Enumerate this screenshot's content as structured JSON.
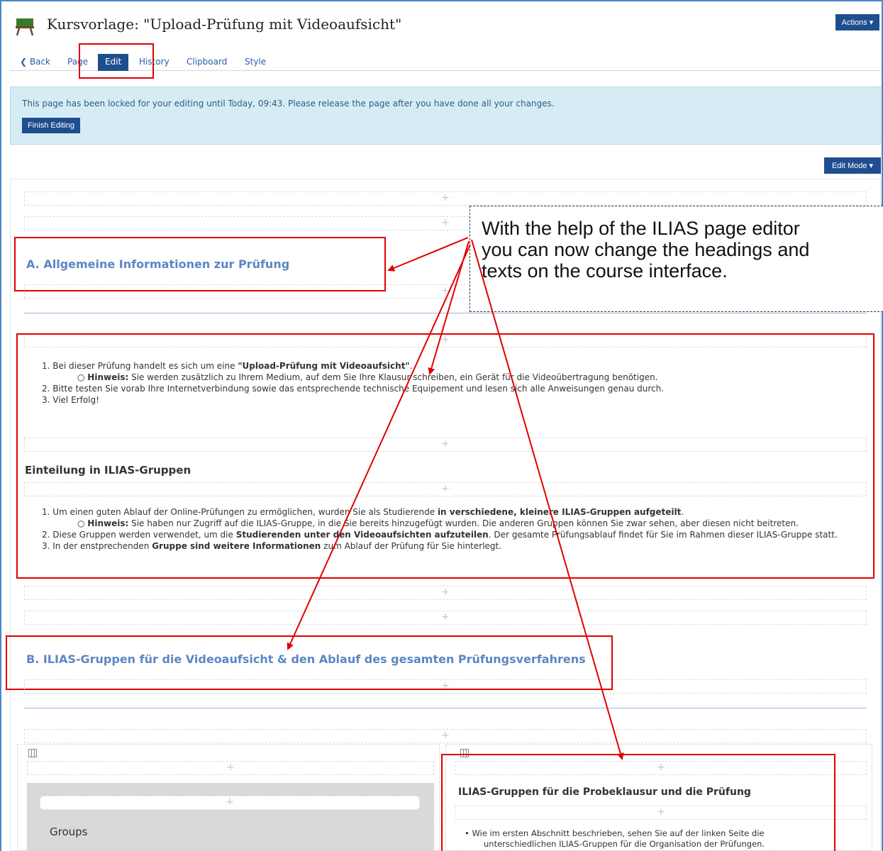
{
  "header": {
    "title": "Kursvorlage: \"Upload-Prüfung mit Videoaufsicht\"",
    "actions_label": "Actions ▾"
  },
  "tabs": {
    "back": "❮ Back",
    "page": "Page",
    "edit": "Edit",
    "history": "History",
    "clipboard": "Clipboard",
    "style": "Style"
  },
  "lock": {
    "message": "This page has been locked for your editing until Today, 09:43. Please release the page after you have done all your changes.",
    "finish_label": "Finish Editing"
  },
  "edit_mode_label": "Edit Mode ▾",
  "placeholder_glyph": "+",
  "section_a": {
    "heading": "A. Allgemeine Informationen zur Prüfung",
    "items": {
      "i1_pre": "1. Bei dieser Prüfung handelt es sich um eine ",
      "i1_bold": "\"Upload-Prüfung mit Videoaufsicht\"",
      "i1_post": ".",
      "i1a_bold": "Hinweis:",
      "i1a_text": " Sie werden zusätzlich zu Ihrem Medium, auf dem Sie Ihre Klausur schreiben, ein Gerät für die Videoübertragung benötigen.",
      "i2": "2. Bitte testen Sie vorab Ihre Internetverbindung sowie das entsprechende technische Equipement und lesen sich alle Anweisungen genau durch.",
      "i3": "3. Viel Erfolg!"
    },
    "subheading": "Einteilung in ILIAS-Gruppen",
    "items2": {
      "i1_pre": "1. Um einen guten Ablauf der Online-Prüfungen zu ermöglichen, wurden Sie als Studierende ",
      "i1_bold": "in verschiedene, kleinere ILIAS-Gruppen aufgeteilt",
      "i1_post": ".",
      "i1a_bold": "Hinweis:",
      "i1a_text": " Sie haben nur Zugriff auf die ILIAS-Gruppe, in die Sie bereits hinzugefügt wurden. Die anderen Gruppen können Sie zwar sehen, aber diesen nicht beitreten.",
      "i2_pre": "2. Diese Gruppen werden verwendet, um die ",
      "i2_bold": "Studierenden unter den Videoaufsichten aufzuteilen",
      "i2_post": ". Der gesamte Prüfungsablauf findet für Sie im Rahmen dieser ILIAS-Gruppe statt.",
      "i3_pre": "3. In der enstprechenden ",
      "i3_bold": "Gruppe sind weitere Informationen",
      "i3_post": " zum Ablauf der Prüfung für Sie hinterlegt."
    }
  },
  "section_b": {
    "heading": "B. ILIAS-Gruppen für die Videoaufsicht & den Ablauf des gesamten Prüfungsverfahrens",
    "groups_label": "Groups",
    "right_heading": "ILIAS-Gruppen für die Probeklausur und die Prüfung",
    "right_item_1": "• Wie im ersten Abschnitt beschrieben, sehen Sie auf der linken Seite die",
    "right_item_2": "unterschiedlichen ILIAS-Gruppen für die Organisation der Prüfungen."
  },
  "callout": {
    "line1": "With the help of the ILIAS page editor",
    "line2": "you can now change the headings and",
    "line3": "texts on the course interface."
  },
  "colors": {
    "primary_button": "#1f4e8f",
    "link": "#2a5ea8",
    "heading_blue": "#5a87c5",
    "annotation_red": "#e00000",
    "lock_background": "#d6ecf5"
  }
}
